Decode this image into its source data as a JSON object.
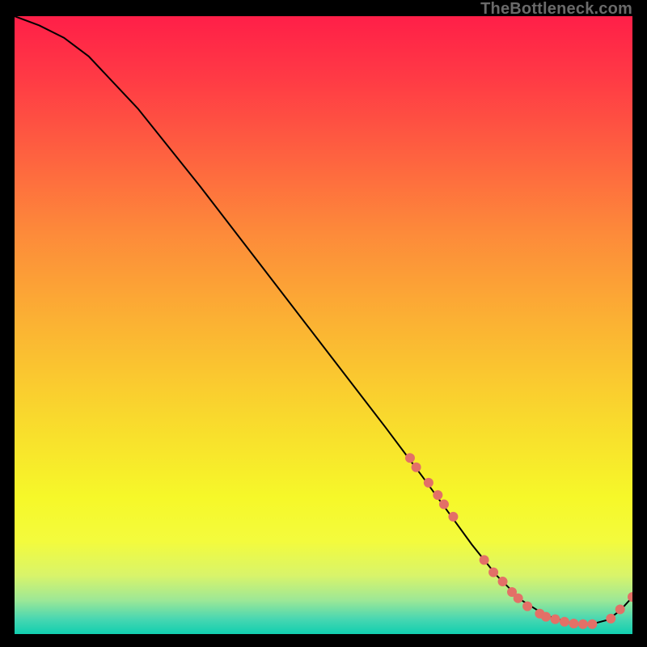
{
  "watermark": "TheBottleneck.com",
  "gradient": {
    "stops": [
      {
        "offset": 0.0,
        "color": "#ff1f48"
      },
      {
        "offset": 0.1,
        "color": "#ff3a45"
      },
      {
        "offset": 0.22,
        "color": "#fe6040"
      },
      {
        "offset": 0.35,
        "color": "#fd8a3a"
      },
      {
        "offset": 0.5,
        "color": "#fbb333"
      },
      {
        "offset": 0.65,
        "color": "#f9d92d"
      },
      {
        "offset": 0.78,
        "color": "#f6f829"
      },
      {
        "offset": 0.85,
        "color": "#f3fb3d"
      },
      {
        "offset": 0.905,
        "color": "#d9f46a"
      },
      {
        "offset": 0.945,
        "color": "#9de896"
      },
      {
        "offset": 0.975,
        "color": "#4ad7b1"
      },
      {
        "offset": 1.0,
        "color": "#10cfb0"
      }
    ]
  },
  "chart_data": {
    "type": "line",
    "title": "",
    "xlabel": "",
    "ylabel": "",
    "xlim": [
      0,
      100
    ],
    "ylim": [
      0,
      100
    ],
    "grid": false,
    "legend": false,
    "series": [
      {
        "name": "bottleneck-curve",
        "x": [
          0,
          4,
          8,
          12,
          20,
          30,
          40,
          50,
          60,
          66,
          70,
          74,
          78,
          82,
          86,
          90,
          93,
          96,
          98,
          100
        ],
        "y": [
          100,
          98.5,
          96.5,
          93.5,
          85,
          72.5,
          59.5,
          46.5,
          33.5,
          25.5,
          20,
          14.5,
          9.5,
          5.5,
          3,
          1.8,
          1.5,
          2.3,
          3.8,
          6
        ],
        "color": "#000000",
        "linewidth": 2
      }
    ],
    "markers": {
      "name": "highlighted-points",
      "color": "#e37067",
      "radius": 6,
      "x": [
        64,
        65,
        67,
        68.5,
        69.5,
        71,
        76,
        77.5,
        79,
        80.5,
        81.5,
        83,
        85,
        86,
        87.5,
        89,
        90.5,
        92,
        93.5,
        96.5,
        98,
        100
      ],
      "y": [
        28.5,
        27,
        24.5,
        22.5,
        21,
        19,
        12,
        10,
        8.5,
        6.8,
        5.8,
        4.5,
        3.3,
        2.8,
        2.4,
        2.0,
        1.7,
        1.6,
        1.6,
        2.5,
        4.0,
        6.0
      ]
    }
  }
}
